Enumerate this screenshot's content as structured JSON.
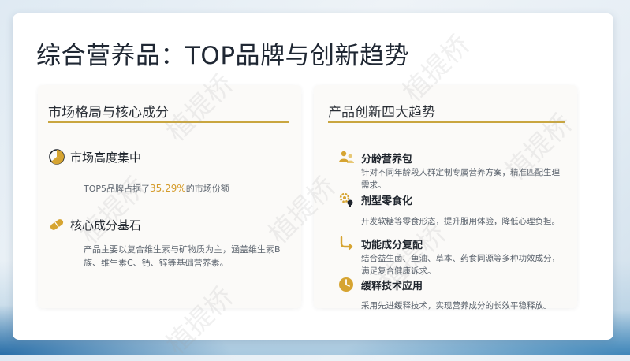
{
  "title": "综合营养品：TOP品牌与创新趋势",
  "left_card": {
    "title": "市场格局与核心成分",
    "section1": {
      "icon": "pie-chart-icon",
      "heading": "市场高度集中",
      "text_before": "TOP5品牌占据了",
      "highlight": "35.29%",
      "text_after": "的市场份额"
    },
    "section2": {
      "icon": "pill-icon",
      "heading": "核心成分基石",
      "text": "产品主要以复合维生素与矿物质为主，涵盖维生素B族、维生素C、钙、锌等基础营养素。"
    }
  },
  "right_card": {
    "title": "产品创新四大趋势",
    "trends": [
      {
        "icon": "people-icon",
        "heading": "分龄营养包",
        "text": "针对不同年龄段人群定制专属营养方案，精准匹配生理需求。"
      },
      {
        "icon": "gear-bulb-icon",
        "heading": "剂型零食化",
        "text": "开发软糖等零食形态，提升服用体验，降低心理负担。"
      },
      {
        "icon": "route-icon",
        "heading": "功能成分复配",
        "text": "结合益生菌、鱼油、草本、药食同源等多种功效成分，满足复合健康诉求。"
      },
      {
        "icon": "clock-icon",
        "heading": "缓释技术应用",
        "text": "采用先进缓释技术，实现营养成分的长效平稳释放。"
      }
    ]
  },
  "watermark": "植提桥",
  "colors": {
    "accent": "#c9a640",
    "highlight": "#d49b2a",
    "icon": "#d6a431"
  }
}
